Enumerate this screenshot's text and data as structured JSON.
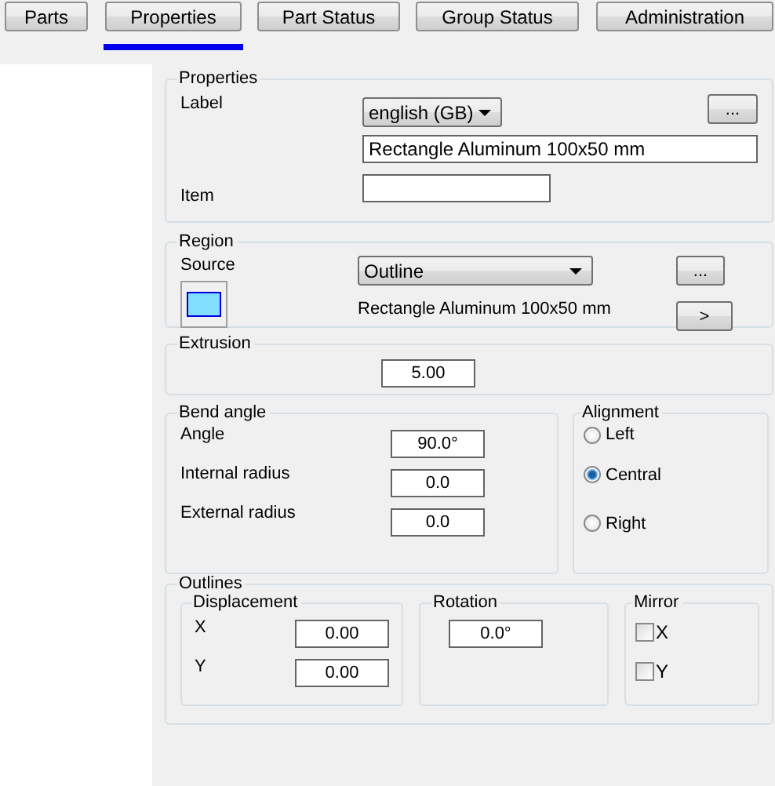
{
  "tabs": [
    {
      "label": "Parts",
      "selected": false
    },
    {
      "label": "Properties",
      "selected": true
    },
    {
      "label": "Part Status",
      "selected": false
    },
    {
      "label": "Group Status",
      "selected": false
    },
    {
      "label": "Administration",
      "selected": false
    }
  ],
  "properties": {
    "title": "Properties",
    "label_caption": "Label",
    "language": "english (GB)",
    "more_button": "...",
    "label_value": "Rectangle Aluminum 100x50 mm",
    "item_caption": "Item"
  },
  "region": {
    "title": "Region",
    "source_caption": "Source",
    "source_select": "Outline",
    "more_button": "...",
    "description": "Rectangle Aluminum 100x50 mm",
    "next_button": ">"
  },
  "extrusion": {
    "title": "Extrusion",
    "value": "5.00"
  },
  "bend_angle": {
    "title": "Bend angle",
    "fields": [
      {
        "label": "Angle",
        "value": "90.0°"
      },
      {
        "label": "Internal radius",
        "value": "0.0"
      },
      {
        "label": "External radius",
        "value": "0.0"
      }
    ]
  },
  "alignment": {
    "title": "Alignment",
    "options": [
      {
        "label": "Left",
        "selected": false
      },
      {
        "label": "Central",
        "selected": true
      },
      {
        "label": "Right",
        "selected": false
      }
    ]
  },
  "outlines": {
    "title": "Outlines",
    "displacement": {
      "title": "Displacement",
      "fields": [
        {
          "label": "X",
          "value": "0.00"
        },
        {
          "label": "Y",
          "value": "0.00"
        }
      ]
    },
    "rotation": {
      "title": "Rotation",
      "value": "0.0°"
    },
    "mirror": {
      "title": "Mirror",
      "options": [
        {
          "label": "X",
          "checked": false
        },
        {
          "label": "Y",
          "checked": false
        }
      ]
    }
  }
}
